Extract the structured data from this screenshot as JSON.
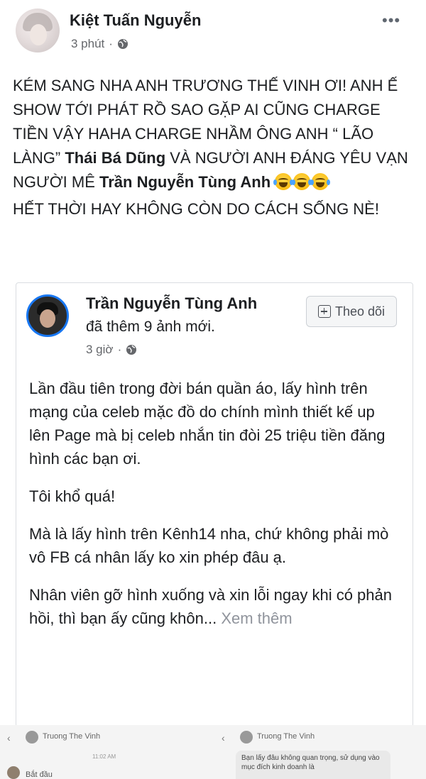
{
  "post": {
    "author": "Kiệt Tuấn Nguyễn",
    "time": "3 phút",
    "separator": "·",
    "privacy_icon": "globe-icon",
    "more_icon": "•••",
    "text_part1": "KÉM SANG NHA ANH TRƯƠNG THẾ VINH ƠI! ANH Ế SHOW TỚI PHÁT RỒ SAO GẶP AI CŨNG CHARGE TIỀN VẬY HAHA CHARGE NHẦM ÔNG ANH “ LÃO LÀNG” ",
    "mention1": "Thái Bá Dũng",
    "text_part2": " VÀ NGƯỜI ANH ĐÁNG YÊU VẠN NGƯỜI MÊ ",
    "mention2": "Trần Nguyễn Tùng Anh",
    "emojis": "face-with-tears-of-joy x3",
    "text_part3": "HẾT THỜI HAY KHÔNG CÒN DO CÁCH SỐNG NÈ!"
  },
  "shared": {
    "author": "Trần Nguyễn Tùng Anh",
    "subtitle": "đã thêm 9 ảnh mới.",
    "time": "3 giờ",
    "separator": "·",
    "follow_label": "Theo dõi",
    "paragraphs": [
      "Lần đầu tiên trong đời bán quần áo, lấy hình trên mạng của celeb mặc đồ do chính mình thiết kế up lên Page mà bị celeb nhắn tin đòi 25 triệu tiền đăng hình các bạn ơi.",
      "Tôi khổ quá!",
      "Mà là lấy hình trên Kênh14 nha, chứ không phải mò vô FB cá nhân lấy ko xin phép đâu ạ.",
      "Nhân viên gỡ hình xuống và xin lỗi ngay khi có phản hồi, thì bạn ấy cũng khôn..."
    ],
    "see_more": "Xem thêm"
  },
  "preview": {
    "left_name": "Truong The Vinh",
    "right_name": "Truong The Vinh",
    "time": "11:02 AM",
    "start_label": "Bắt đầu",
    "bubble_text": "Bạn lấy đâu không quan trọng, sử dụng vào mục đích kinh doanh là"
  },
  "colors": {
    "text": "#1c1e21",
    "meta": "#65676b",
    "accent": "#1877f2",
    "see_more": "#90949c"
  }
}
